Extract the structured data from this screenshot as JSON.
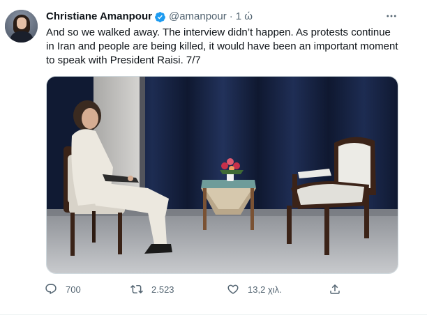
{
  "tweet": {
    "author": {
      "name": "Christiane Amanpour",
      "handle": "@amanpour",
      "separator": "·",
      "time": "1 ώ",
      "verified": true
    },
    "text_lines": [
      "And so we walked away. The interview didn’t happen. As protests continue",
      "in Iran and people are being killed, it would have been an important moment",
      "to speak with President Raisi. 7/7"
    ],
    "media": {
      "type": "photo"
    },
    "actions": {
      "reply_count": "700",
      "retweet_count": "2.523",
      "like_count": "13,2 χιλ."
    }
  },
  "icons": {
    "verified": "verified-badge-icon",
    "more": "more-options-icon",
    "reply": "reply-icon",
    "retweet": "retweet-icon",
    "like": "heart-icon",
    "share": "share-icon"
  },
  "colors": {
    "verified_blue": "#1d9bf0",
    "text_primary": "#0f1419",
    "text_secondary": "#536471",
    "border": "#cfd9de"
  }
}
